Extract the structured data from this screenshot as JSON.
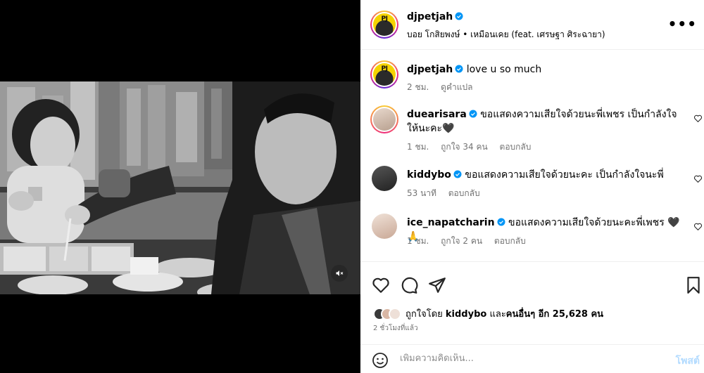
{
  "post": {
    "author": "djpetjah",
    "audio": "บอย โกสิยพงษ์ • เหมือนเคย (feat. เศรษฐา ศิระฉายา)",
    "avatar_logo": "PJ"
  },
  "caption": {
    "username": "djpetjah",
    "text": "love u so much",
    "time": "2 ชม.",
    "translate": "ดูคำแปล"
  },
  "comments": [
    {
      "username": "duearisara",
      "text": "ขอแสดงความเสียใจด้วยนะพี่เพชร เป็นกำลังใจให้นะคะ🖤",
      "time": "1 ชม.",
      "likes": "ถูกใจ 34 คน",
      "reply": "ตอบกลับ"
    },
    {
      "username": "kiddybo",
      "text": "ขอแสดงความเสียใจด้วยนะคะ เป็นกำลังใจนะพี่",
      "time": "53 นาที",
      "likes": "",
      "reply": "ตอบกลับ"
    },
    {
      "username": "ice_napatcharin",
      "text": "ขอแสดงความเสียใจด้วยนะคะพี่เพชร 🖤 🙏",
      "time": "1 ชม.",
      "likes": "ถูกใจ 2 คน",
      "reply": "ตอบกลับ"
    }
  ],
  "likes_summary": {
    "prefix": "ถูกใจโดย",
    "user": "kiddybo",
    "middle": "และ",
    "others": "คนอื่นๆ อีก 25,628 คน"
  },
  "time_ago": "2 ชั่วโมงที่แล้ว",
  "composer": {
    "placeholder": "เพิ่มความคิดเห็น...",
    "post_label": "โพสต์"
  },
  "icons": {
    "like": "heart-outline-icon",
    "comment": "speech-bubble-icon",
    "share": "paper-plane-icon",
    "save": "bookmark-icon",
    "mute": "speaker-muted-icon",
    "emoji": "smiley-icon",
    "more": "more-horizontal-icon",
    "verified": "verified-badge-icon"
  },
  "colors": {
    "verified": "#0095f6",
    "muted_text": "#737373",
    "post_button_disabled": "#b3dbff"
  }
}
